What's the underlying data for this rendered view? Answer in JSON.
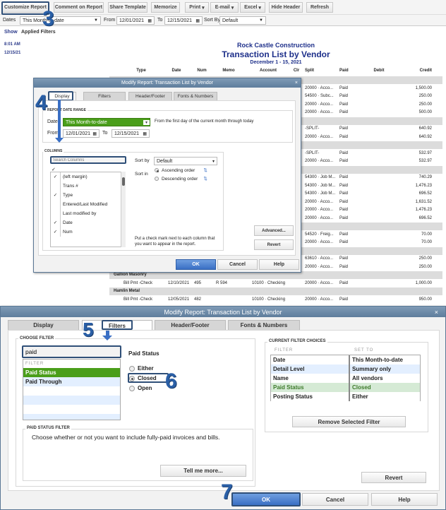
{
  "toolbar": {
    "customize": "Customize Report",
    "comment": "Comment on Report",
    "share": "Share Template",
    "memorize": "Memorize",
    "print": "Print",
    "email": "E-mail",
    "excel": "Excel",
    "hide_header": "Hide Header",
    "refresh": "Refresh"
  },
  "filterbar": {
    "dates_label": "Dates",
    "dates_value": "This Month-to-date",
    "from_label": "From",
    "from_value": "12/01/2021",
    "to_label": "To",
    "to_value": "12/15/2021",
    "sortby_label": "Sort By",
    "sortby_value": "Default"
  },
  "report": {
    "show": "Show",
    "applied_filters": "Applied Filters",
    "time": "8:01 AM",
    "date": "12/15/21",
    "company": "Rock Castle Construction",
    "title": "Transaction List by Vendor",
    "period": "December 1 - 15, 2021",
    "columns": [
      "Type",
      "Date",
      "Num",
      "Memo",
      "Account",
      "Clr",
      "Split",
      "Paid",
      "Debit",
      "Credit"
    ],
    "rows": [
      {
        "g": ""
      },
      {
        "split": "20000 · Acco...",
        "paid": "Paid",
        "credit": "1,500.00"
      },
      {
        "split": "54500 · Subc...",
        "paid": "Paid",
        "credit": "250.00"
      },
      {
        "split": "20000 · Acco...",
        "paid": "Paid",
        "credit": "250.00"
      },
      {
        "split": "20000 · Acco...",
        "paid": "Paid",
        "credit": "500.00"
      },
      {
        "g": ""
      },
      {
        "split": "-SPLIT-",
        "paid": "Paid",
        "credit": "640.92"
      },
      {
        "split": "20000 · Acco...",
        "paid": "Paid",
        "credit": "640.92"
      },
      {
        "g": ""
      },
      {
        "split": "-SPLIT-",
        "paid": "Paid",
        "credit": "532.97"
      },
      {
        "split": "20000 · Acco...",
        "paid": "Paid",
        "credit": "532.97"
      },
      {
        "g": ""
      },
      {
        "split": "54300 · Job M...",
        "paid": "Paid",
        "credit": "740.29"
      },
      {
        "split": "54300 · Job M...",
        "paid": "Paid",
        "credit": "1,476.23"
      },
      {
        "split": "54300 · Job M...",
        "paid": "Paid",
        "credit": "696.52"
      },
      {
        "split": "20000 · Acco...",
        "paid": "Paid",
        "credit": "1,631.52"
      },
      {
        "split": "20000 · Acco...",
        "paid": "Paid",
        "credit": "1,476.23"
      },
      {
        "split": "20000 · Acco...",
        "paid": "Paid",
        "credit": "696.52"
      },
      {
        "g": ""
      },
      {
        "split": "54520 · Freig...",
        "paid": "Paid",
        "credit": "70.00"
      },
      {
        "split": "20000 · Acco...",
        "paid": "Paid",
        "credit": "70.00"
      },
      {
        "g": ""
      },
      {
        "split": "63610 · Acco...",
        "paid": "Paid",
        "credit": "250.00"
      },
      {
        "split": "20000 · Acco...",
        "paid": "Paid",
        "credit": "250.00"
      },
      {
        "g": "Gallion Masonry"
      },
      {
        "type": "Bill Pmt -Check",
        "date": "12/10/2021",
        "num": "495",
        "memo": "R 594",
        "account": "10100 · Checking",
        "split": "20000 · Acco...",
        "paid": "Paid",
        "credit": "1,000.00"
      },
      {
        "g": "Hamlin Metal"
      },
      {
        "type": "Bill Pmt -Check",
        "date": "12/05/2021",
        "num": "482",
        "memo": "",
        "account": "10100 · Checking",
        "split": "20000 · Acco...",
        "paid": "Paid",
        "credit": "950.00"
      }
    ]
  },
  "dialog1": {
    "title": "Modify Report: Transaction List by Vendor",
    "close": "×",
    "tabs": [
      "Display",
      "Filters",
      "Header/Footer",
      "Fonts & Numbers"
    ],
    "date_range_label": "REPORT DATE RANGE",
    "dates_label": "Dates",
    "dates_value": "This Month-to-date",
    "dates_desc": "From the first day of the current month through today",
    "from_label": "From",
    "from_value": "12/01/2021",
    "to_label": "To",
    "to_value": "12/15/2021",
    "columns_label": "COLUMNS",
    "search_placeholder": "Search Columns",
    "check_header": "✓",
    "columns": [
      {
        "c": "✓",
        "n": "(left margin)"
      },
      {
        "c": "",
        "n": "Trans #"
      },
      {
        "c": "✓",
        "n": "Type"
      },
      {
        "c": "",
        "n": "Entered/Last Modified"
      },
      {
        "c": "",
        "n": "Last modified by"
      },
      {
        "c": "✓",
        "n": "Date"
      },
      {
        "c": "✓",
        "n": "Num"
      }
    ],
    "sortby_label": "Sort by",
    "sortby_value": "Default",
    "sortin_label": "Sort in",
    "ascending": "Ascending order",
    "descending": "Descending order",
    "hint": "Put a check mark next to each column that you want to appear in the report.",
    "advanced": "Advanced...",
    "revert": "Revert",
    "ok": "OK",
    "cancel": "Cancel",
    "help": "Help"
  },
  "dialog2": {
    "title": "Modify Report: Transaction List by Vendor",
    "close": "×",
    "tabs": [
      "Display",
      "Filters",
      "Header/Footer",
      "Fonts & Numbers"
    ],
    "choose_filter": "CHOOSE FILTER",
    "search_value": "paid",
    "filter_header": "FILTER",
    "filters": [
      "Paid Status",
      "Paid Through"
    ],
    "paid_status_label": "Paid Status",
    "options": [
      "Either",
      "Closed",
      "Open"
    ],
    "selected_option": "Closed",
    "status_filter_label": "PAID STATUS FILTER",
    "status_desc": "Choose whether or not you want to include fully-paid invoices and bills.",
    "tell_more": "Tell me more...",
    "current_label": "CURRENT FILTER CHOICES",
    "cur_col_filter": "FILTER",
    "cur_col_set": "SET TO",
    "current": [
      {
        "f": "Date",
        "s": "This Month-to-date"
      },
      {
        "f": "Detail Level",
        "s": "Summary only"
      },
      {
        "f": "Name",
        "s": "All vendors"
      },
      {
        "f": "Paid Status",
        "s": "Closed"
      },
      {
        "f": "Posting Status",
        "s": "Either"
      }
    ],
    "remove": "Remove Selected Filter",
    "revert": "Revert",
    "ok": "OK",
    "cancel": "Cancel",
    "help": "Help"
  },
  "steps": [
    "3",
    "4",
    "5",
    "6",
    "7"
  ],
  "colors": {
    "accent_green": "#4a9e1a",
    "step_blue": "#2a5fa6",
    "title_bar": "#5e7d9c"
  }
}
